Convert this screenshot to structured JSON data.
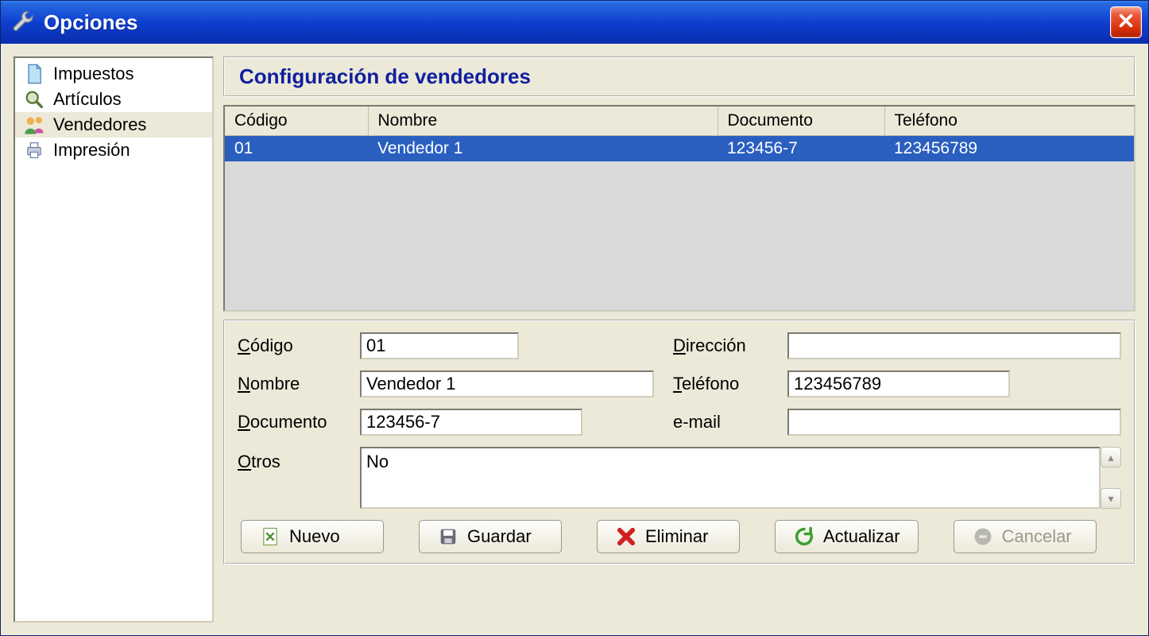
{
  "window": {
    "title": "Opciones"
  },
  "sidebar": {
    "items": [
      {
        "label": "Impuestos",
        "icon": "document-icon"
      },
      {
        "label": "Artículos",
        "icon": "search-icon"
      },
      {
        "label": "Vendedores",
        "icon": "people-icon",
        "selected": true
      },
      {
        "label": "Impresión",
        "icon": "printer-icon"
      }
    ]
  },
  "main": {
    "title": "Configuración de vendedores",
    "table": {
      "headers": [
        "Código",
        "Nombre",
        "Documento",
        "Teléfono"
      ],
      "rows": [
        {
          "codigo": "01",
          "nombre": "Vendedor 1",
          "documento": "123456-7",
          "telefono": "123456789",
          "selected": true
        }
      ]
    },
    "form": {
      "labels": {
        "codigo": "Código",
        "nombre": "Nombre",
        "documento": "Documento",
        "direccion": "Dirección",
        "telefono": "Teléfono",
        "email": "e-mail",
        "otros": "Otros"
      },
      "values": {
        "codigo": "01",
        "nombre": "Vendedor 1",
        "documento": "123456-7",
        "direccion": "",
        "telefono": "123456789",
        "email": "",
        "otros": "No"
      }
    },
    "buttons": {
      "nuevo": "Nuevo",
      "guardar": "Guardar",
      "eliminar": "Eliminar",
      "actualizar": "Actualizar",
      "cancelar": "Cancelar"
    }
  }
}
